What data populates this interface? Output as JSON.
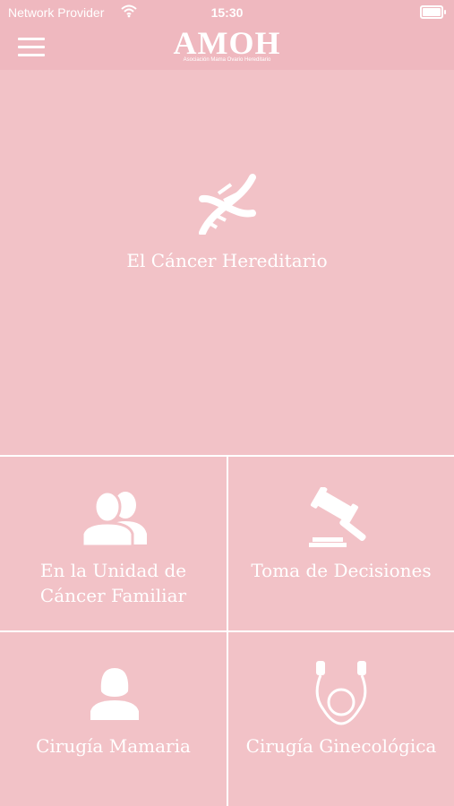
{
  "status_bar": {
    "carrier": "Network Provider",
    "time": "15:30"
  },
  "header": {
    "logo_title": "AMOH",
    "logo_subtitle": "Asociación Mama Ovario Hereditario",
    "menu_icon": "hamburger-icon"
  },
  "tiles": [
    {
      "label": "El Cáncer Hereditario",
      "icon": "dna-icon"
    },
    {
      "label_line1": "En la Unidad de",
      "label_line2": "Cáncer Familiar",
      "icon": "people-icon"
    },
    {
      "label": "Toma de Decisiones",
      "icon": "gavel-icon"
    },
    {
      "label": "Cirugía Mamaria",
      "icon": "woman-icon"
    },
    {
      "label": "Cirugía Ginecológica",
      "icon": "stethoscope-icon"
    }
  ],
  "colors": {
    "background": "#f2c2c7",
    "header": "#efb8bf",
    "foreground": "#ffffff"
  }
}
